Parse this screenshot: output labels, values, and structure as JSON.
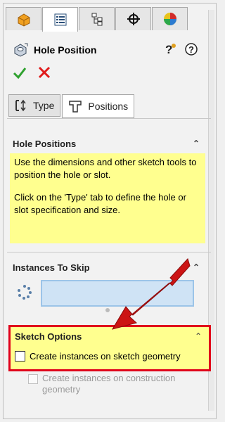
{
  "tabs": [
    {
      "icon": "feature-manager-icon"
    },
    {
      "icon": "property-manager-icon",
      "active": true
    },
    {
      "icon": "configuration-manager-icon"
    },
    {
      "icon": "dimxpert-icon"
    },
    {
      "icon": "display-manager-icon"
    }
  ],
  "header": {
    "title": "Hole Position"
  },
  "subtabs": [
    {
      "label": "Type"
    },
    {
      "label": "Positions",
      "active": true
    }
  ],
  "hole_positions": {
    "title": "Hole Positions",
    "message1": "Use the dimensions and other sketch tools to position the hole or slot.",
    "message2": "Click on the 'Type' tab to define the hole or slot specification and size."
  },
  "instances_to_skip": {
    "title": "Instances To Skip"
  },
  "sketch_options": {
    "title": "Sketch Options",
    "option1": "Create instances on sketch geometry",
    "option2_line1": "Create instances on construction",
    "option2_line2": "geometry"
  },
  "colors": {
    "highlight": "#ffff8f",
    "arrow": "#cc1414",
    "border": "#e0001b"
  }
}
